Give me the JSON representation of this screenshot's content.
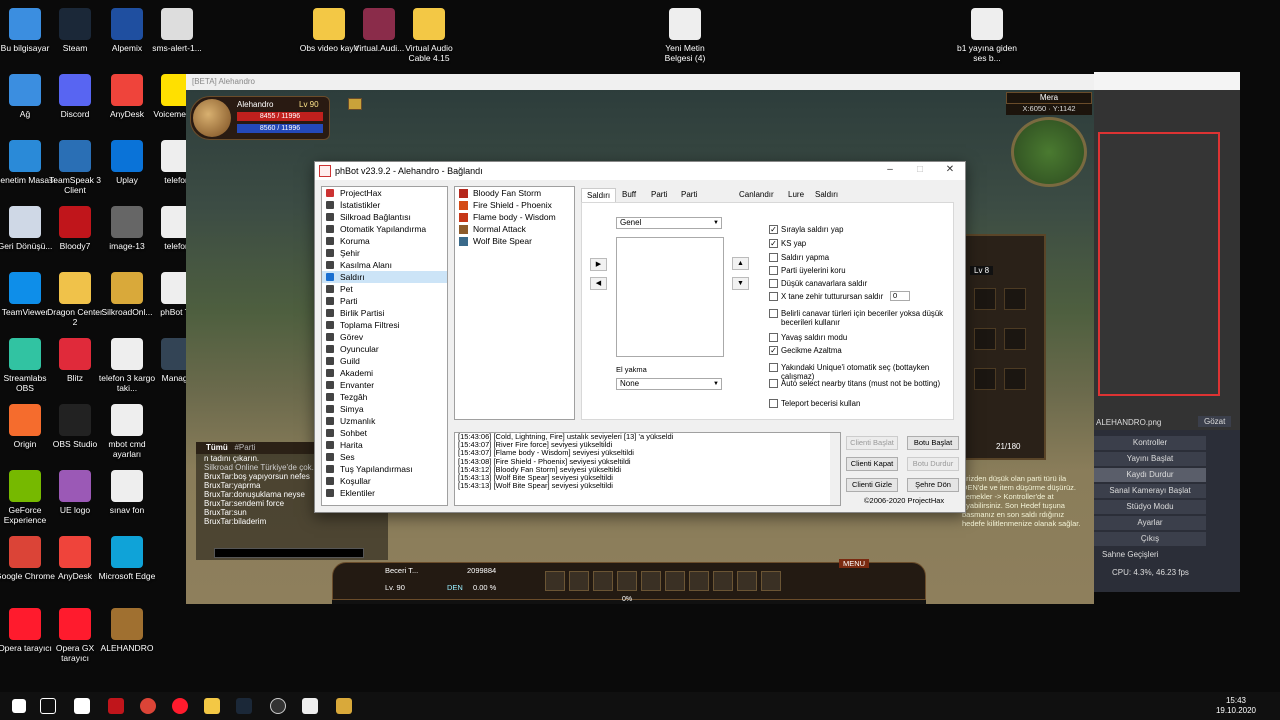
{
  "desktop_icons": [
    {
      "label": "Bu bilgisayar",
      "color": "#3b8ee0"
    },
    {
      "label": "Steam",
      "color": "#1b2838"
    },
    {
      "label": "Alpemix",
      "color": "#1f4fa0"
    },
    {
      "label": "sms-alert-1...",
      "color": "#ddd"
    },
    {
      "label": "Ağ",
      "color": "#3b8ee0"
    },
    {
      "label": "Discord",
      "color": "#5865f2"
    },
    {
      "label": "AnyDesk",
      "color": "#ef443b"
    },
    {
      "label": "Voicemeeter",
      "color": "#ffe000"
    },
    {
      "label": "Denetim Masası",
      "color": "#2a8ad8"
    },
    {
      "label": "TeamSpeak 3 Client",
      "color": "#2a6fb5"
    },
    {
      "label": "Uplay",
      "color": "#0a73d8"
    },
    {
      "label": "telefon",
      "color": "#eee"
    },
    {
      "label": "Geri Dönüşü...",
      "color": "#cfd8e6"
    },
    {
      "label": "Bloody7",
      "color": "#c0151b"
    },
    {
      "label": "image-13",
      "color": "#666"
    },
    {
      "label": "telefon",
      "color": "#eee"
    },
    {
      "label": "TeamViewer",
      "color": "#0e8ee9"
    },
    {
      "label": "Dragon Center 2",
      "color": "#f0c24a"
    },
    {
      "label": "SilkroadOnl...",
      "color": "#d9a93a"
    },
    {
      "label": "phBot Te",
      "color": "#eee"
    },
    {
      "label": "Streamlabs OBS",
      "color": "#31c3a2"
    },
    {
      "label": "Blitz",
      "color": "#e02a3a"
    },
    {
      "label": "telefon 3 kargo taki...",
      "color": "#eee"
    },
    {
      "label": "Manage",
      "color": "#345"
    },
    {
      "label": "Origin",
      "color": "#f56c2d"
    },
    {
      "label": "OBS Studio",
      "color": "#222"
    },
    {
      "label": "mbot cmd ayarları",
      "color": "#eee"
    },
    {
      "label": "GeForce Experience",
      "color": "#76b900"
    },
    {
      "label": "UE logo",
      "color": "#9b59b6"
    },
    {
      "label": "sınav fon",
      "color": "#eee"
    },
    {
      "label": "Google Chrome",
      "color": "#db4437"
    },
    {
      "label": "AnyDesk",
      "color": "#ef443b"
    },
    {
      "label": "Microsoft Edge",
      "color": "#0fa3d8"
    },
    {
      "label": "Opera tarayıcı",
      "color": "#ff1b2d"
    },
    {
      "label": "Opera GX tarayıcı",
      "color": "#ff1b2d"
    },
    {
      "label": "ALEHANDRO",
      "color": "#a07030"
    },
    {
      "label": "Obs video kayıt",
      "color": "#f3c845"
    },
    {
      "label": "Virtual.Audi...",
      "color": "#8a2c4a"
    },
    {
      "label": "Virtual Audio Cable 4.15",
      "color": "#f3c845"
    },
    {
      "label": "Yeni Metin Belgesi (4)",
      "color": "#eee"
    },
    {
      "label": "b1 yayına giden ses b...",
      "color": "#eee"
    }
  ],
  "game": {
    "title": "[BETA] Alehandro",
    "char_name": "Alehandro",
    "level": "Lv 90",
    "hp": "8455 / 11996",
    "mp": "8560 / 11996",
    "map_name": "Mera",
    "coords": "X:6050 · Y:1142",
    "chat_tabs": [
      "Tümü",
      "#Parti"
    ],
    "chat_lines": [
      "n tadını çıkarın.",
      "Silkroad Online Türkiye'de çok...",
      "BruxTar:boş yapıyorsun nefes",
      "BruxTar:yaprma",
      "BruxTar:donuşuklama neyse",
      "BruxTar:sendemi force",
      "BruxTar:sun",
      "BruxTar:biladerim"
    ],
    "skill_label": "Beceri T...",
    "skill_points": "2099884",
    "hb_level": "Lv. 90",
    "hb_den": "DEN",
    "exp_pct": "0.00 %",
    "exp_bar": "0%",
    "menu_label": "MENU",
    "panel_level": "Lv 8",
    "panel_count": "21/180",
    "notice": "erizden düşük olan parti türü ila DEN'de ve item düşürme düşürüz. semekler -> Kontroller'de at ayabilirsiniz. Son Hedef tuşuna basmanız en son saldı rdığınız hedefe kilitlenmenize olanak sağlar."
  },
  "obs": {
    "filename": "ALEHANDRO.png",
    "browse": "Gözat",
    "menu": [
      "Kontroller",
      "Yayını Başlat",
      "Kaydı Durdur",
      "Sanal Kamerayı Başlat",
      "Stüdyo Modu",
      "Ayarlar",
      "Çıkış",
      "Sahne Geçişleri"
    ],
    "status": "CPU: 4.3%, 46.23 fps"
  },
  "phbot": {
    "title": "phBot v23.9.2 - Alehandro - Bağlandı",
    "nav": [
      {
        "label": "ProjectHax",
        "icon": "red-x-icon",
        "color": "#c33"
      },
      {
        "label": "İstatistikler",
        "icon": "stats-icon",
        "color": "#444"
      },
      {
        "label": "Silkroad Bağlantısı",
        "icon": "plug-icon",
        "color": "#444"
      },
      {
        "label": "Otomatik Yapılandırma",
        "icon": "gear-icon",
        "color": "#444"
      },
      {
        "label": "Koruma",
        "icon": "shield-icon",
        "color": "#444"
      },
      {
        "label": "Şehir",
        "icon": "city-icon",
        "color": "#444"
      },
      {
        "label": "Kasılma Alanı",
        "icon": "target-icon",
        "color": "#444"
      },
      {
        "label": "Saldırı",
        "icon": "sword-icon",
        "color": "#1a6fd0"
      },
      {
        "label": "Pet",
        "icon": "pet-icon",
        "color": "#444"
      },
      {
        "label": "Parti",
        "icon": "party-icon",
        "color": "#444"
      },
      {
        "label": "Birlik Partisi",
        "icon": "union-icon",
        "color": "#444"
      },
      {
        "label": "Toplama Filtresi",
        "icon": "filter-icon",
        "color": "#444"
      },
      {
        "label": "Görev",
        "icon": "quest-icon",
        "color": "#444"
      },
      {
        "label": "Oyuncular",
        "icon": "players-icon",
        "color": "#444"
      },
      {
        "label": "Guild",
        "icon": "guild-icon",
        "color": "#444"
      },
      {
        "label": "Akademi",
        "icon": "academy-icon",
        "color": "#444"
      },
      {
        "label": "Envanter",
        "icon": "inventory-icon",
        "color": "#444"
      },
      {
        "label": "Tezgâh",
        "icon": "stall-icon",
        "color": "#444"
      },
      {
        "label": "Simya",
        "icon": "alchemy-icon",
        "color": "#444"
      },
      {
        "label": "Uzmanlık",
        "icon": "mastery-icon",
        "color": "#444"
      },
      {
        "label": "Sohbet",
        "icon": "chat-icon",
        "color": "#444"
      },
      {
        "label": "Harita",
        "icon": "map-icon",
        "color": "#444"
      },
      {
        "label": "Ses",
        "icon": "sound-icon",
        "color": "#444"
      },
      {
        "label": "Tuş Yapılandırması",
        "icon": "keyboard-icon",
        "color": "#444"
      },
      {
        "label": "Koşullar",
        "icon": "conditions-icon",
        "color": "#444"
      },
      {
        "label": "Eklentiler",
        "icon": "plugins-icon",
        "color": "#444"
      }
    ],
    "selected_nav": "Saldırı",
    "skills": [
      {
        "label": "Bloody Fan Storm",
        "color": "#b5271c"
      },
      {
        "label": "Fire Shield - Phoenix",
        "color": "#d44a14"
      },
      {
        "label": "Flame body - Wisdom",
        "color": "#c63617"
      },
      {
        "label": "Normal Attack",
        "color": "#8d5b2a"
      },
      {
        "label": "Wolf Bite Spear",
        "color": "#3a6a8a"
      }
    ],
    "tabs": [
      "Saldırı",
      "Buff",
      "Parti",
      "Parti Ayarları",
      "Canlandır",
      "Lure",
      "Saldırı Kaydı"
    ],
    "active_tab": "Saldırı",
    "group_select": "Genel",
    "imbue_label": "El yakma",
    "imbue_select": "None",
    "options": [
      {
        "label": "Sırayla saldırı yap",
        "checked": true
      },
      {
        "label": "KS yap",
        "checked": true
      },
      {
        "label": "Saldırı yapma",
        "checked": false
      },
      {
        "label": "Parti üyelerini koru",
        "checked": false
      },
      {
        "label": "Düşük canavarlara saldır",
        "checked": false
      },
      {
        "label": "X tane zehir tutturursan saldır",
        "checked": false
      },
      {
        "label": "Belirli canavar türleri için beceriler yoksa düşük becerileri kullanır",
        "checked": false
      },
      {
        "label": "Yavaş saldırı modu",
        "checked": false
      },
      {
        "label": "Gecikme Azaltma",
        "checked": true
      },
      {
        "label": "Yakındaki Unique'i otomatik seç (bottayken çalışmaz)",
        "checked": false
      },
      {
        "label": "Auto select nearby titans (must not be botting)",
        "checked": false
      },
      {
        "label": "Teleport becerisi kullan",
        "checked": false
      }
    ],
    "poison_count": "0",
    "log": [
      "[15:43:06] [Cold, Lightning, Fire] ustalık seviyeleri [13] 'a yükseldi",
      "[15:43:07] [River Fire force] seviyesi yükseltildi",
      "[15:43:07] [Flame body - Wisdom] seviyesi yükseltildi",
      "[15:43:08] [Fire Shield - Phoenix] seviyesi yükseltildi",
      "[15:43:12] [Bloody Fan Storm] seviyesi yükseltildi",
      "[15:43:13] [Wolf Bite Spear] seviyesi yükseltildi",
      "[15:43:13] [Wolf Bite Spear] seviyesi yükseltildi"
    ],
    "buttons": {
      "client_start": "Clienti Başlat",
      "bot_start": "Botu Başlat",
      "client_close": "Clienti Kapat",
      "bot_stop": "Botu Durdur",
      "client_hide": "Clienti Gizle",
      "town_return": "Şehre Dön"
    },
    "copyright": "©2006-2020 ProjectHax"
  },
  "taskbar": {
    "time": "15:43",
    "date": "19.10.2020"
  }
}
